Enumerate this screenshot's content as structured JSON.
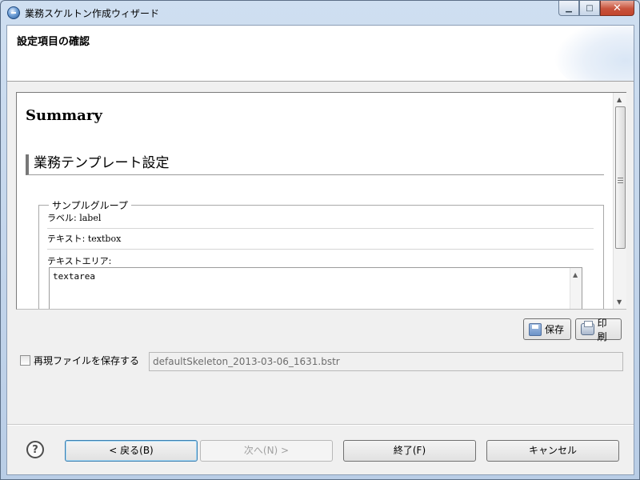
{
  "window": {
    "title": "業務スケルトン作成ウィザード"
  },
  "header": {
    "title": "設定項目の確認"
  },
  "summary": {
    "title": "Summary",
    "section_heading": "業務テンプレート設定",
    "group_legend": "サンプルグループ",
    "fields": [
      {
        "label": "ラベル: ",
        "value": "label"
      },
      {
        "label": "テキスト: ",
        "value": "textbox"
      }
    ],
    "textarea_label": "テキストエリア:",
    "textarea_value": "textarea"
  },
  "actions": {
    "save_label": "保存",
    "print_label": "印刷"
  },
  "replay": {
    "checkbox_label": "再現ファイルを保存する",
    "checked": false,
    "file_value": "defaultSkeleton_2013-03-06_1631.bstr"
  },
  "footer": {
    "help": "?",
    "back_label": "< 戻る(B)",
    "next_label": "次へ(N) >",
    "finish_label": "終了(F)",
    "cancel_label": "キャンセル"
  },
  "colors": {
    "window_chrome": "#c9d9ec",
    "close_button": "#c8533c",
    "default_button_border": "#3c7fb1"
  }
}
